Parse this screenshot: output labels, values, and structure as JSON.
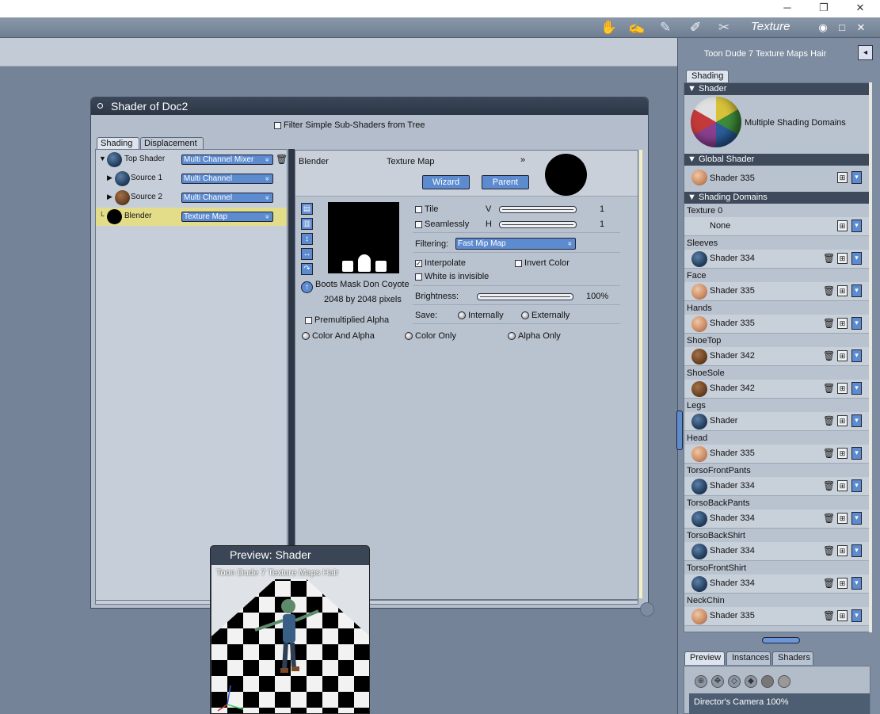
{
  "window_controls": {
    "minimize": "─",
    "restore": "❐",
    "close": "✕"
  },
  "toolbar": {
    "room_title": "Texture",
    "icons": [
      "pose-room-icon",
      "face-room-icon",
      "hair-room-icon",
      "texture-room-icon",
      "cloth-room-icon"
    ]
  },
  "right_panel": {
    "title": "Toon Dude 7 Texture Maps Hair",
    "tabs": [
      "Shading"
    ],
    "shader_header": "Shader",
    "shader_label": "Multiple Shading Domains",
    "global_header": "Global Shader",
    "global_shader": "Shader 335",
    "domains_header": "Shading Domains",
    "domains": [
      {
        "label": "Texture 0",
        "shader": "None",
        "ball": "none"
      },
      {
        "label": "Sleeves",
        "shader": "Shader 334",
        "ball": "blue"
      },
      {
        "label": "Face",
        "shader": "Shader 335",
        "ball": "skin"
      },
      {
        "label": "Hands",
        "shader": "Shader 335",
        "ball": "skin"
      },
      {
        "label": "ShoeTop",
        "shader": "Shader 342",
        "ball": "brown"
      },
      {
        "label": "ShoeSole",
        "shader": "Shader 342",
        "ball": "brown"
      },
      {
        "label": "Legs",
        "shader": "Shader",
        "ball": "blue"
      },
      {
        "label": "Head",
        "shader": "Shader 335",
        "ball": "skin"
      },
      {
        "label": "TorsoFrontPants",
        "shader": "Shader 334",
        "ball": "blue"
      },
      {
        "label": "TorsoBackPants",
        "shader": "Shader 334",
        "ball": "blue"
      },
      {
        "label": "TorsoBackShirt",
        "shader": "Shader 334",
        "ball": "blue"
      },
      {
        "label": "TorsoFrontShirt",
        "shader": "Shader 334",
        "ball": "blue"
      },
      {
        "label": "NeckChin",
        "shader": "Shader 335",
        "ball": "skin"
      }
    ],
    "bottom_tabs": [
      "Preview",
      "Instances",
      "Shaders"
    ],
    "camera_label": "Director's Camera 100%"
  },
  "shader_window": {
    "title": "Shader of Doc2",
    "filter_label": "Filter Simple Sub-Shaders from Tree",
    "tabs": [
      "Shading",
      "Displacement"
    ],
    "tree": [
      {
        "name": "Top Shader",
        "type": "Multi Channel Mixer",
        "ball": "blue"
      },
      {
        "name": "Source 1",
        "type": "Multi Channel",
        "ball": "blue"
      },
      {
        "name": "Source 2",
        "type": "Multi Channel",
        "ball": "brown"
      },
      {
        "name": "Blender",
        "type": "Texture Map",
        "ball": "black"
      }
    ],
    "editor": {
      "node_name": "Blender",
      "node_type": "Texture Map",
      "wizard_label": "Wizard",
      "parent_label": "Parent",
      "tile_label": "Tile",
      "seamlessly_label": "Seamlessly",
      "v_label": "V",
      "v_value": "1",
      "h_label": "H",
      "h_value": "1",
      "filtering_label": "Filtering:",
      "filtering_value": "Fast Mip Map",
      "interpolate_label": "Interpolate",
      "invert_label": "Invert Color",
      "white_invisible_label": "White is invisible",
      "brightness_label": "Brightness:",
      "brightness_value": "100%",
      "save_label": "Save:",
      "save_internally": "Internally",
      "save_externally": "Externally",
      "map_name": "Boots Mask Don Coyote",
      "map_size": "2048 by 2048 pixels",
      "premult_label": "Premultiplied Alpha",
      "radio_color_alpha": "Color And Alpha",
      "radio_color_only": "Color Only",
      "radio_alpha_only": "Alpha Only"
    }
  },
  "preview_window": {
    "title": "Preview: Shader",
    "label": "Toon Dude 7 Texture Maps Hair"
  }
}
